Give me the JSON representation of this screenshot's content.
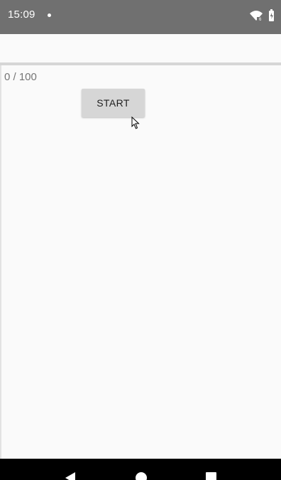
{
  "status_bar": {
    "time": "15:09",
    "icons": [
      "notification-dot-icon",
      "wifi-icon",
      "battery-icon"
    ],
    "background_color": "#707070"
  },
  "main": {
    "progress_text": "0 / 100",
    "start_button_label": "START"
  },
  "nav_bar": {
    "icons": [
      "back-icon",
      "home-icon",
      "recents-icon"
    ]
  }
}
